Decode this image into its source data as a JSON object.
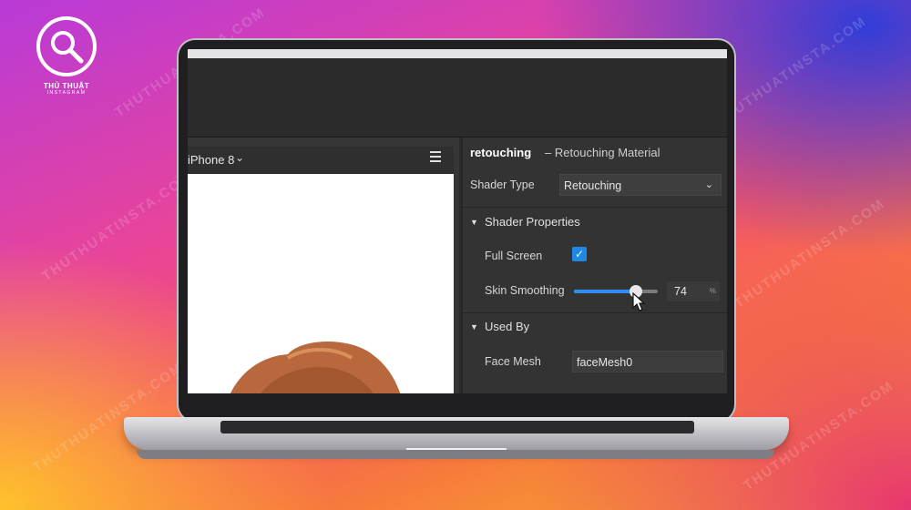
{
  "brand": {
    "name": "THỦ THUẬT",
    "tagline": "INSTAGRAM",
    "watermark": "THUTHUATINSTA.COM"
  },
  "preview_panel": {
    "device": "iPhone 8"
  },
  "inspector": {
    "title": "retouching",
    "subtitle": "– Retouching Material",
    "shader_type": {
      "label": "Shader Type",
      "value": "Retouching"
    },
    "shader_properties": {
      "title": "Shader Properties",
      "full_screen": {
        "label": "Full Screen",
        "checked": true
      },
      "skin_smoothing": {
        "label": "Skin Smoothing",
        "value": "74",
        "unit": "%",
        "slider_fraction": 0.74
      }
    },
    "used_by": {
      "title": "Used By",
      "face_mesh": {
        "label": "Face Mesh",
        "value": "faceMesh0"
      }
    }
  },
  "colors": {
    "accent": "#2f8ff0",
    "checkbox": "#1e88e5",
    "panel": "#333333"
  }
}
